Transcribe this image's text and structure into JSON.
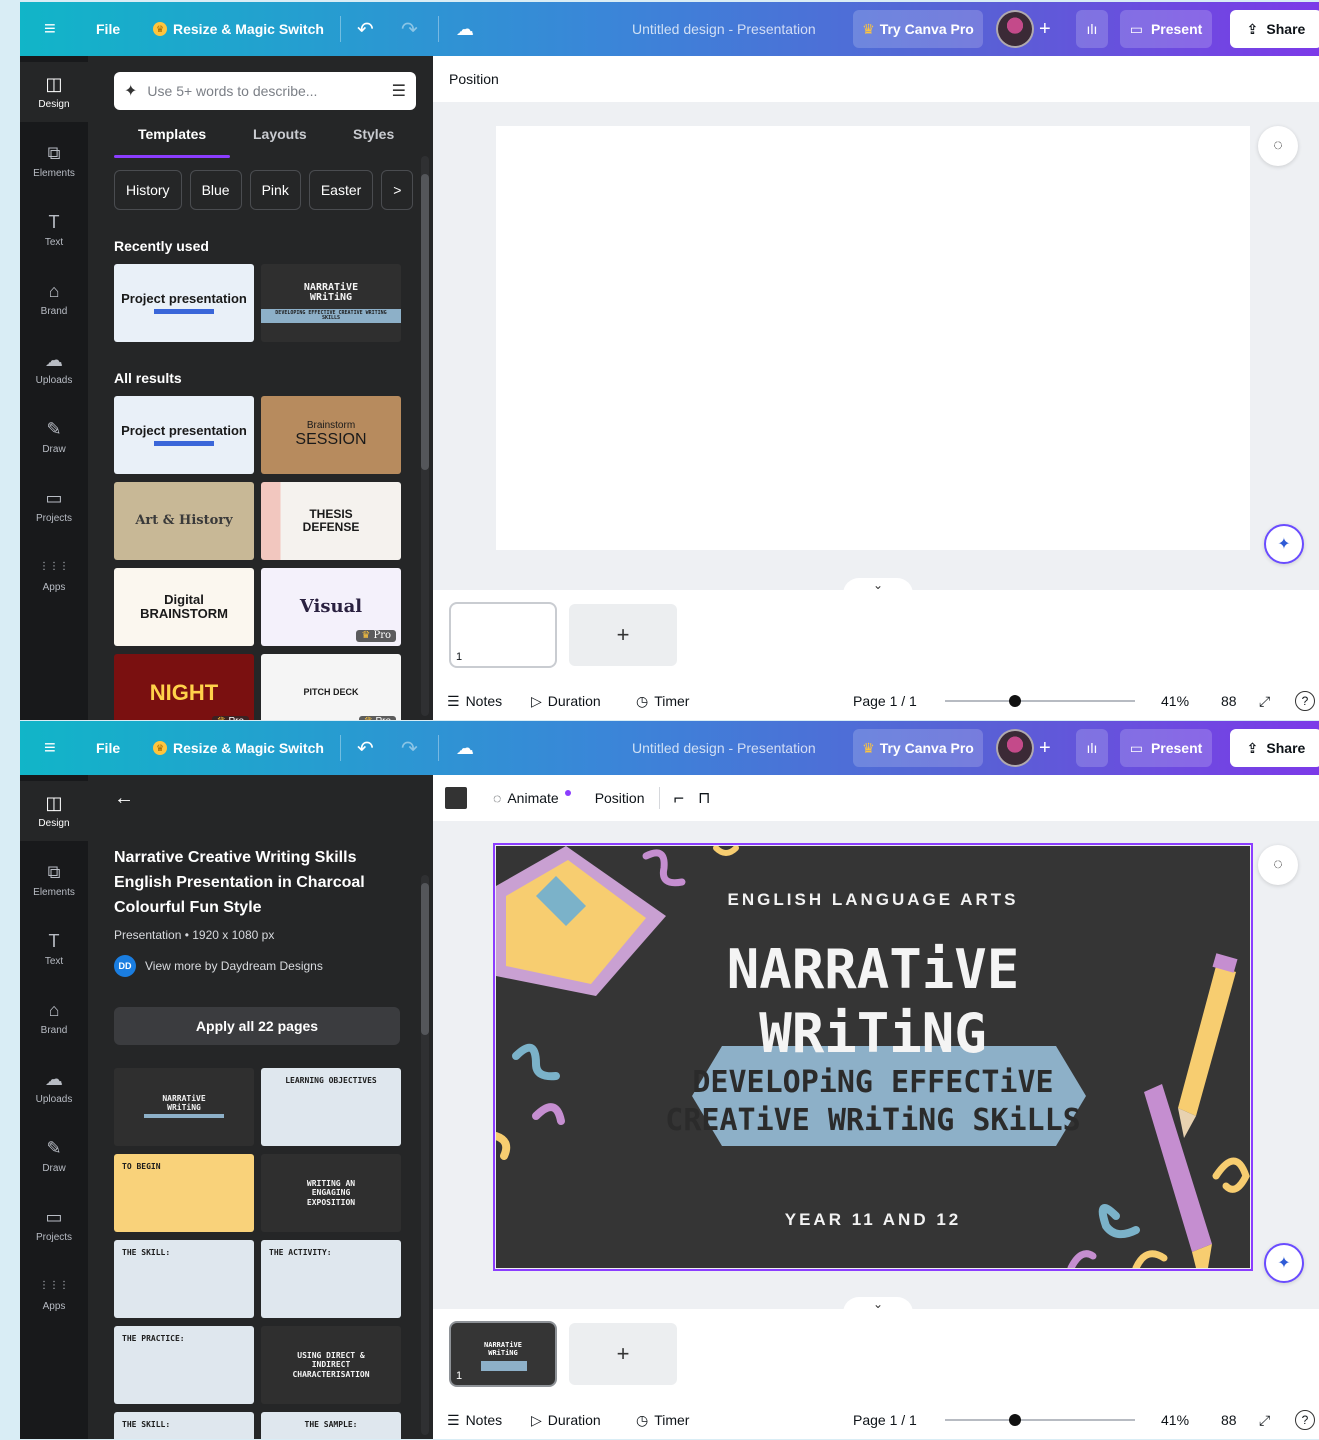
{
  "topbar": {
    "file": "File",
    "resize": "Resize & Magic Switch",
    "title": "Untitled design - Presentation",
    "try_pro": "Try Canva Pro",
    "present": "Present",
    "share": "Share",
    "menu_icon": "≡",
    "undo_icon": "↶",
    "redo_icon": "↷",
    "cloud_icon": "☁",
    "plus_icon": "+",
    "chart_icon": "ılı",
    "present_icon": "▭",
    "share_icon": "⇪",
    "crown_icon": "♛"
  },
  "rail": {
    "items": [
      {
        "label": "Design",
        "icon": "◫"
      },
      {
        "label": "Elements",
        "icon": "⧉"
      },
      {
        "label": "Text",
        "icon": "T"
      },
      {
        "label": "Brand",
        "icon": "⌂"
      },
      {
        "label": "Uploads",
        "icon": "☁"
      },
      {
        "label": "Draw",
        "icon": "✎"
      },
      {
        "label": "Projects",
        "icon": "▭"
      },
      {
        "label": "Apps",
        "icon": "⋮⋮⋮"
      }
    ]
  },
  "panel1": {
    "search_placeholder": "Use 5+ words to describe...",
    "search_icon": "✦",
    "filter_icon": "☰",
    "tabs": [
      "Templates",
      "Layouts",
      "Styles"
    ],
    "chips": [
      "History",
      "Blue",
      "Pink",
      "Easter",
      ">"
    ],
    "recently_used": "Recently used",
    "all_results": "All results",
    "thumbs": {
      "project": "Project presentation",
      "narrative_line1": "NARRATiVE",
      "narrative_line2": "WRiTiNG",
      "narrative_sub": "DEVELOPING EFFECTIVE CREATIVE WRITING SKILLS",
      "brainstorm_a": "Brainstorm",
      "brainstorm_b": "SESSION",
      "art": "Art & History",
      "thesis": "THESIS DEFENSE",
      "digital_a": "Digital",
      "digital_b": "BRAINSTORM",
      "visual": "Visual",
      "night": "NIGHT",
      "pitch": "PITCH DECK",
      "pro": "Pro"
    }
  },
  "panel2": {
    "back_icon": "←",
    "title": "Narrative Creative Writing Skills English Presentation in Charcoal Colourful Fun Style",
    "meta": "Presentation • 1920 x 1080 px",
    "author_initials": "DD",
    "author": "View more by Daydream Designs",
    "apply": "Apply all 22 pages",
    "pages": [
      {
        "kind": "dark",
        "text": "NARRATiVE WRiTiNG"
      },
      {
        "kind": "light",
        "text": "LEARNING OBJECTIVES"
      },
      {
        "kind": "yellow",
        "text": "TO BEGIN"
      },
      {
        "kind": "dark",
        "text": "WRITING AN ENGAGING EXPOSITION"
      },
      {
        "kind": "lightl",
        "text": "THE SKILL:"
      },
      {
        "kind": "lightl",
        "text": "THE ACTIVITY:"
      },
      {
        "kind": "lightl",
        "text": "THE PRACTICE:"
      },
      {
        "kind": "dark",
        "text": "USING DIRECT & INDIRECT CHARACTERISATION"
      },
      {
        "kind": "lightl",
        "text": "THE SKILL:"
      },
      {
        "kind": "lightl",
        "text": "THE SAMPLE:"
      }
    ]
  },
  "canvas": {
    "position": "Position",
    "animate": "Animate",
    "slide": {
      "kicker": "ENGLISH LANGUAGE ARTS",
      "title1": "NARRATiVE",
      "title2": "WRiTiNG",
      "banner1": "DEVELOPiNG EFFECTiVE",
      "banner2": "CREATiVE WRiTiNG SKiLLS",
      "year": "YEAR 11 AND 12"
    }
  },
  "footer": {
    "notes": "Notes",
    "duration": "Duration",
    "timer": "Timer",
    "page": "Page 1 / 1",
    "zoom": "41%",
    "page_num": "1",
    "add_icon": "+",
    "grid_icon": "88",
    "expand_icon": "⤢",
    "help_icon": "?",
    "notes_icon": "☰",
    "duration_icon": "▷",
    "timer_icon": "◷",
    "chevron_icon": "⌄"
  }
}
